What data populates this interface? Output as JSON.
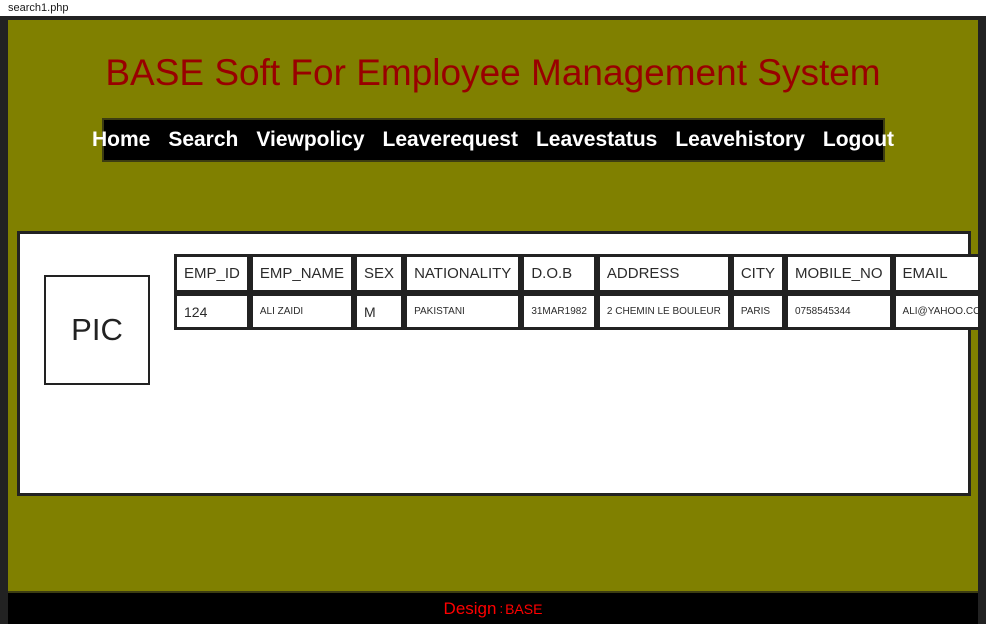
{
  "browser": {
    "tab_title": "search1.php"
  },
  "header": {
    "title": "BASE Soft For Employee Management System",
    "title_color": "#990000",
    "background_color": "#808000"
  },
  "nav": {
    "background_color": "#000000",
    "items": [
      {
        "label": "Home"
      },
      {
        "label": "Search"
      },
      {
        "label": "Viewpolicy"
      },
      {
        "label": "Leaverequest"
      },
      {
        "label": "Leavestatus"
      },
      {
        "label": "Leavehistory"
      },
      {
        "label": "Logout"
      }
    ]
  },
  "main": {
    "photo": {
      "label": "PIC"
    },
    "table": {
      "columns": [
        {
          "key": "emp_id",
          "label": "EMP_ID"
        },
        {
          "key": "emp_name",
          "label": "EMP_NAME"
        },
        {
          "key": "sex",
          "label": "SEX"
        },
        {
          "key": "nationality",
          "label": "NATIONALITY"
        },
        {
          "key": "dob",
          "label": "D.O.B"
        },
        {
          "key": "address",
          "label": "ADDRESS"
        },
        {
          "key": "city",
          "label": "CITY"
        },
        {
          "key": "mobile_no",
          "label": "MOBILE_NO"
        },
        {
          "key": "email",
          "label": "EMAIL"
        }
      ],
      "rows": [
        {
          "emp_id": "124",
          "emp_name": "ALI ZAIDI",
          "sex": "M",
          "nationality": "PAKISTANI",
          "dob": "31MAR1982",
          "address": "2 CHEMIN LE BOULEUR",
          "city": "PARIS",
          "mobile_no": "0758545344",
          "email": "ALI@YAHOO.COM"
        }
      ]
    }
  },
  "footer": {
    "design_word": "Design",
    "separator": ":",
    "brand": "BASE",
    "text_color": "#ff0000",
    "background_color": "#000000"
  }
}
